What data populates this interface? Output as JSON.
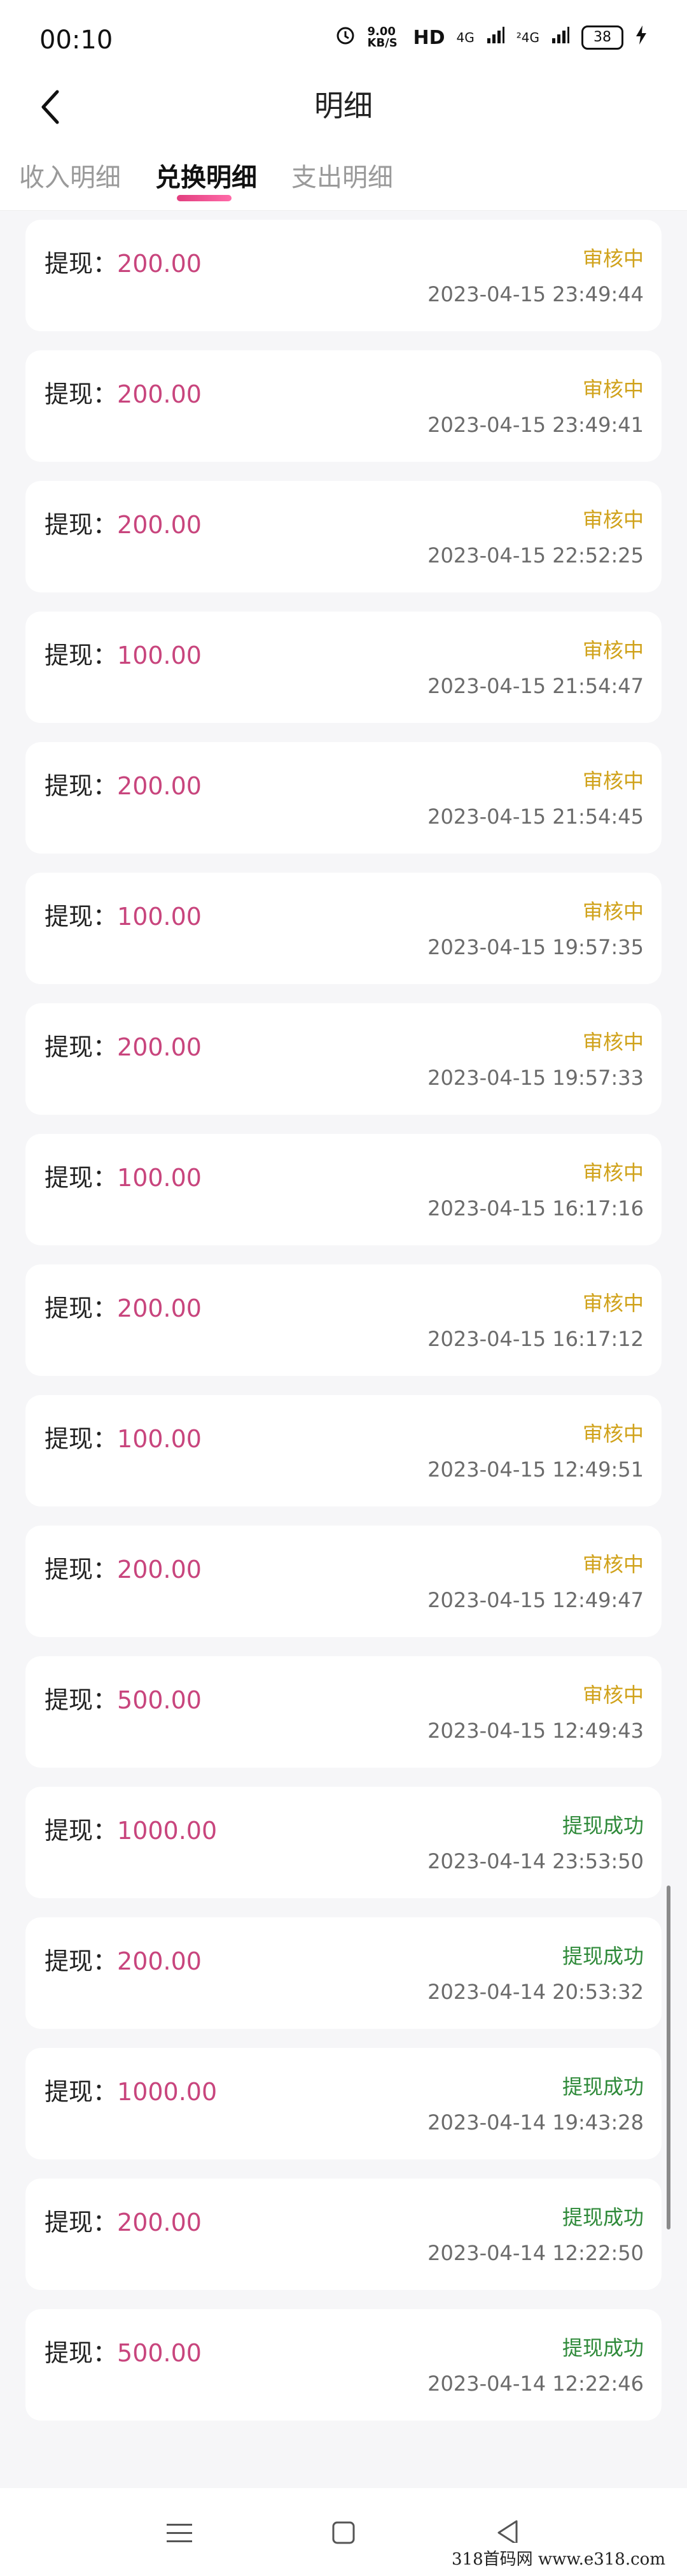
{
  "status_bar": {
    "time": "00:10",
    "network_speed": "9.00 KB/S",
    "hd": "HD",
    "signal1": "4G",
    "signal2": "²4G",
    "battery": "38"
  },
  "header": {
    "title": "明细",
    "back_icon": "chevron-left-icon"
  },
  "tabs": [
    {
      "label": "收入明细",
      "active": false
    },
    {
      "label": "兑换明细",
      "active": true
    },
    {
      "label": "支出明细",
      "active": false
    }
  ],
  "label_prefix": "提现：",
  "records": [
    {
      "amount": "200.00",
      "status": "审核中",
      "time": "2023-04-15 23:49:44",
      "kind": "pending"
    },
    {
      "amount": "200.00",
      "status": "审核中",
      "time": "2023-04-15 23:49:41",
      "kind": "pending"
    },
    {
      "amount": "200.00",
      "status": "审核中",
      "time": "2023-04-15 22:52:25",
      "kind": "pending"
    },
    {
      "amount": "100.00",
      "status": "审核中",
      "time": "2023-04-15 21:54:47",
      "kind": "pending"
    },
    {
      "amount": "200.00",
      "status": "审核中",
      "time": "2023-04-15 21:54:45",
      "kind": "pending"
    },
    {
      "amount": "100.00",
      "status": "审核中",
      "time": "2023-04-15 19:57:35",
      "kind": "pending"
    },
    {
      "amount": "200.00",
      "status": "审核中",
      "time": "2023-04-15 19:57:33",
      "kind": "pending"
    },
    {
      "amount": "100.00",
      "status": "审核中",
      "time": "2023-04-15 16:17:16",
      "kind": "pending"
    },
    {
      "amount": "200.00",
      "status": "审核中",
      "time": "2023-04-15 16:17:12",
      "kind": "pending"
    },
    {
      "amount": "100.00",
      "status": "审核中",
      "time": "2023-04-15 12:49:51",
      "kind": "pending"
    },
    {
      "amount": "200.00",
      "status": "审核中",
      "time": "2023-04-15 12:49:47",
      "kind": "pending"
    },
    {
      "amount": "500.00",
      "status": "审核中",
      "time": "2023-04-15 12:49:43",
      "kind": "pending"
    },
    {
      "amount": "1000.00",
      "status": "提现成功",
      "time": "2023-04-14 23:53:50",
      "kind": "success"
    },
    {
      "amount": "200.00",
      "status": "提现成功",
      "time": "2023-04-14 20:53:32",
      "kind": "success"
    },
    {
      "amount": "1000.00",
      "status": "提现成功",
      "time": "2023-04-14 19:43:28",
      "kind": "success"
    },
    {
      "amount": "200.00",
      "status": "提现成功",
      "time": "2023-04-14 12:22:50",
      "kind": "success"
    },
    {
      "amount": "500.00",
      "status": "提现成功",
      "time": "2023-04-14 12:22:46",
      "kind": "success"
    }
  ],
  "colors": {
    "amount": "#c8457d",
    "pending": "#d0a21b",
    "success": "#2f8a3a",
    "tab_accent": "#e23f7f"
  },
  "nav_icons": [
    "menu-icon",
    "home-square-icon",
    "back-triangle-icon"
  ],
  "watermark": "318首码网 www.e318.com"
}
